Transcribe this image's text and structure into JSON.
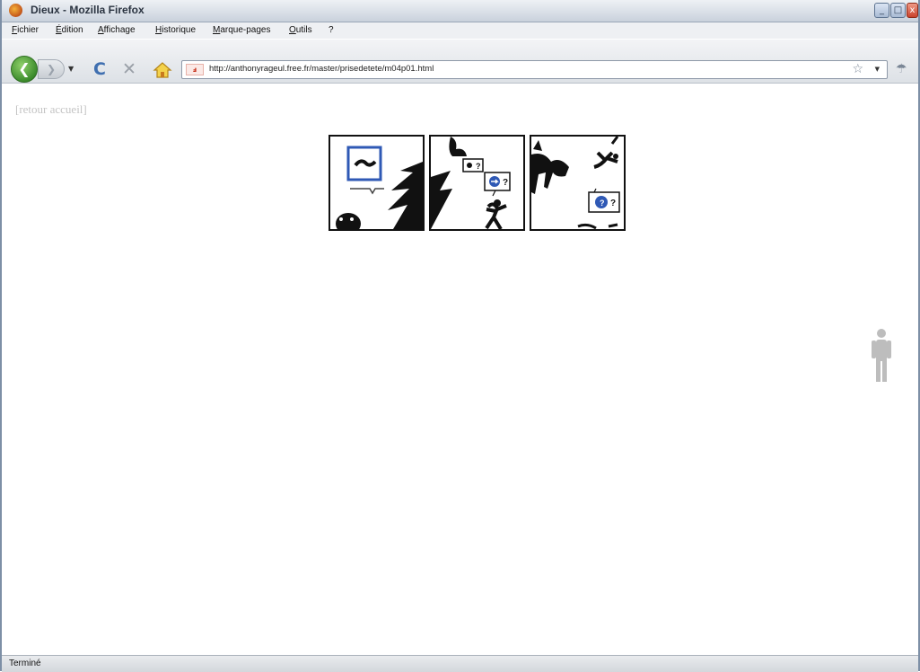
{
  "window": {
    "title": "Dieux - Mozilla Firefox",
    "controls": {
      "minimize": "_",
      "maximize": "□",
      "close": "x"
    }
  },
  "menu": {
    "items": [
      "Fichier",
      "Édition",
      "Affichage",
      "Historique",
      "Marque-pages",
      "Outils",
      "?"
    ]
  },
  "navigation": {
    "url": "http://anthonyrageul.free.fr/master/prisedetete/m04p01.html",
    "icons": {
      "back": "back-arrow-icon",
      "forward": "forward-arrow-icon",
      "reload": "reload-icon",
      "stop": "stop-icon",
      "home": "home-icon",
      "bookmark": "star-icon"
    }
  },
  "page": {
    "back_link": "[retour accueil]",
    "panels": [
      {
        "description": "panel-1"
      },
      {
        "description": "panel-2"
      },
      {
        "description": "panel-3"
      }
    ],
    "bubble_mark": "?"
  },
  "status": {
    "text": "Terminé"
  }
}
